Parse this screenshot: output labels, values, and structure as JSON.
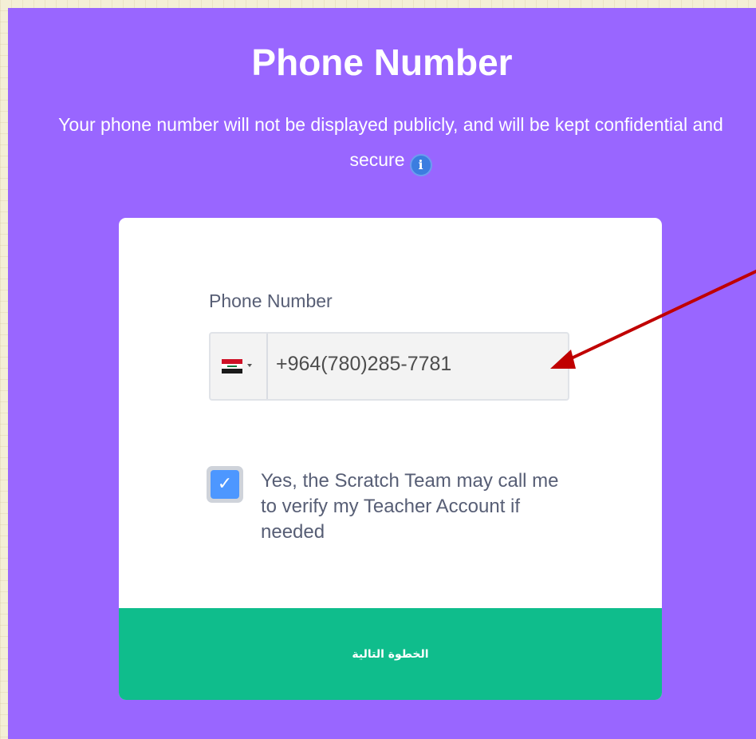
{
  "header": {
    "title": "Phone Number",
    "subtitle": "Your phone number will not be displayed publicly, and will be kept confidential and secure",
    "info_icon_glyph": "i"
  },
  "form": {
    "phone_label": "Phone Number",
    "country_flag": "iraq-flag-icon",
    "phone_value": "+964(780)285-7781",
    "consent_checked": true,
    "check_glyph": "✓",
    "consent_text": "Yes, the Scratch Team may call me to verify my Teacher Account if needed",
    "next_button_label": "الخطوة التالية"
  },
  "colors": {
    "panel_background": "#9966ff",
    "button_green": "#0fbd8c",
    "checkbox_blue": "#4d97ff",
    "annotation_arrow": "#c00000"
  }
}
